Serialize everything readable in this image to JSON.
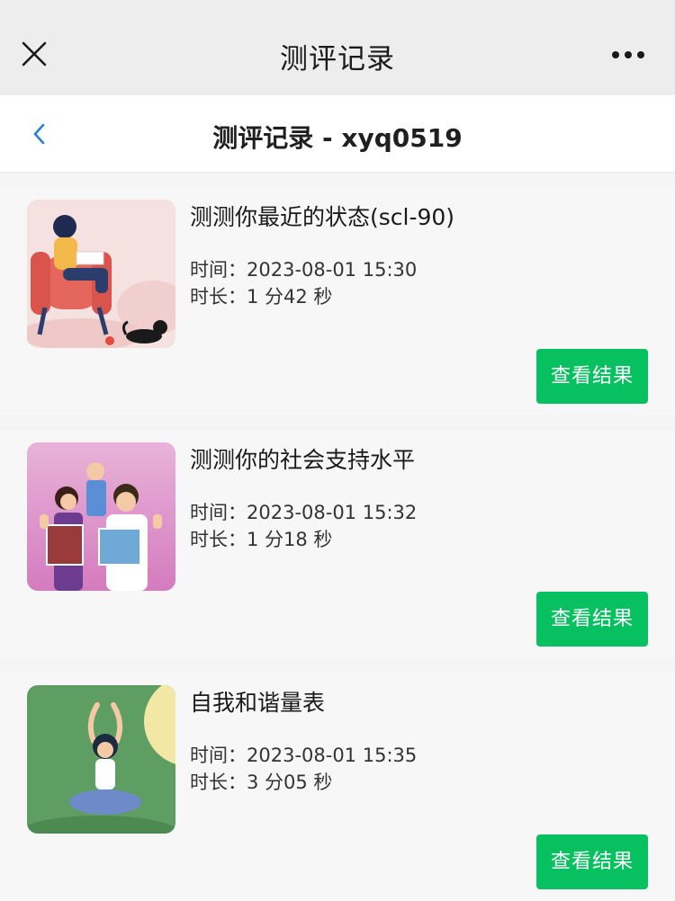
{
  "topbar": {
    "title": "测评记录"
  },
  "subbar": {
    "title": "测评记录 - xyq0519"
  },
  "records": [
    {
      "title": "测测你最近的状态(scl-90)",
      "time_label": "时间：",
      "time": "2023-08-01 15:30",
      "duration_label": "时长：",
      "duration": "1 分42 秒",
      "button": "查看结果"
    },
    {
      "title": "测测你的社会支持水平",
      "time_label": "时间：",
      "time": "2023-08-01 15:32",
      "duration_label": "时长：",
      "duration": "1 分18 秒",
      "button": "查看结果"
    },
    {
      "title": "自我和谐量表",
      "time_label": "时间：",
      "time": "2023-08-01 15:35",
      "duration_label": "时长：",
      "duration": "3 分05 秒",
      "button": "查看结果"
    }
  ],
  "colors": {
    "accent": "#07c160",
    "back": "#2f7fd0"
  }
}
